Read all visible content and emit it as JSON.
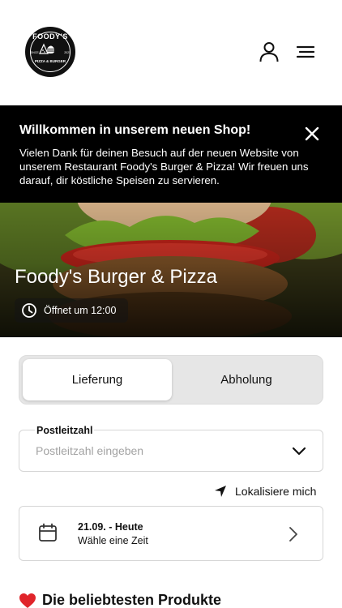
{
  "header": {
    "logo": {
      "top_text": "FOODY'S",
      "bottom_text": "PIZZA & BURGER",
      "since": "SINCE",
      "year": "2021"
    },
    "icons": {
      "account": "user-icon",
      "menu": "hamburger-menu-icon"
    }
  },
  "banner": {
    "title": "Willkommen in unserem neuen Shop!",
    "text": "Vielen Dank für deinen Besuch auf der neuen Website von unserem Restaurant Foody's Burger & Pizza! Wir freuen uns darauf, dir köstliche Speisen zu servieren.",
    "close_icon": "close-icon"
  },
  "hero": {
    "title": "Foody's Burger & Pizza",
    "opening": "Öffnet um 12:00",
    "clock_icon": "clock-icon"
  },
  "order_mode": {
    "options": [
      "Lieferung",
      "Abholung"
    ],
    "selected": "Lieferung"
  },
  "postcode": {
    "label": "Postleitzahl",
    "placeholder": "Postleitzahl eingeben",
    "value": ""
  },
  "locate": {
    "label": "Lokalisiere mich",
    "icon": "location-arrow-icon"
  },
  "time_slot": {
    "date": "21.09. - Heute",
    "hint": "Wähle eine Zeit",
    "icon": "calendar-icon"
  },
  "popular": {
    "title": "Die beliebtesten Produkte",
    "icon": "heart-icon"
  },
  "colors": {
    "banner_bg": "#000000",
    "heart": "#e0242a",
    "segment_bg": "#e6e6e6"
  }
}
